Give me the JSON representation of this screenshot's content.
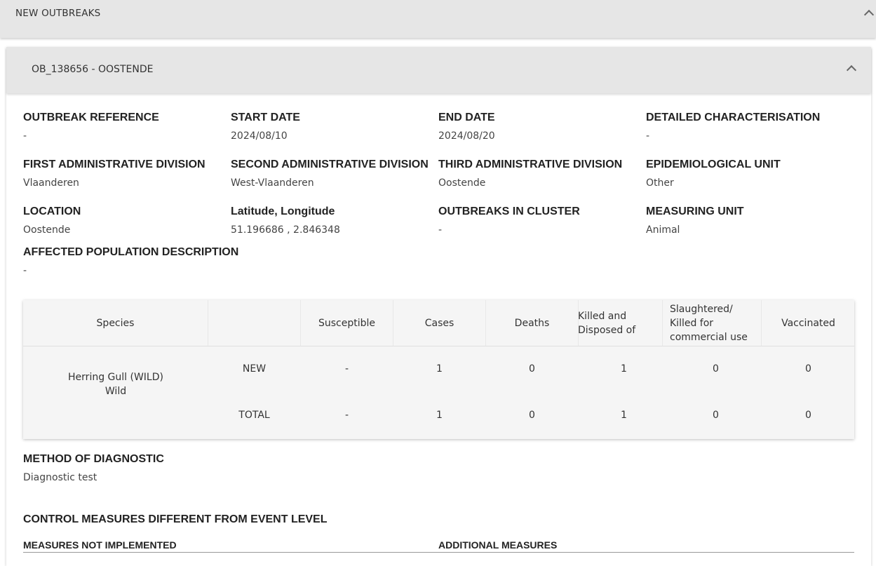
{
  "section": {
    "title": "NEW OUTBREAKS"
  },
  "outbreak": {
    "header": "OB_138656 - OOSTENDE",
    "fields": {
      "outbreak_reference": {
        "label": "OUTBREAK REFERENCE",
        "value": "-"
      },
      "start_date": {
        "label": "START DATE",
        "value": "2024/08/10"
      },
      "end_date": {
        "label": "END DATE",
        "value": "2024/08/20"
      },
      "detailed_characterisation": {
        "label": "DETAILED CHARACTERISATION",
        "value": "-"
      },
      "first_admin_division": {
        "label": "FIRST ADMINISTRATIVE DIVISION",
        "value": "Vlaanderen"
      },
      "second_admin_division": {
        "label": "SECOND ADMINISTRATIVE DIVISION",
        "value": "West-Vlaanderen"
      },
      "third_admin_division": {
        "label": "THIRD ADMINISTRATIVE DIVISION",
        "value": "Oostende"
      },
      "epidemiological_unit": {
        "label": "EPIDEMIOLOGICAL UNIT",
        "value": "Other"
      },
      "location": {
        "label": "LOCATION",
        "value": "Oostende"
      },
      "lat_long": {
        "label": "Latitude, Longitude",
        "value": "51.196686 , 2.846348"
      },
      "outbreaks_in_cluster": {
        "label": "OUTBREAKS IN CLUSTER",
        "value": "-"
      },
      "measuring_unit": {
        "label": "MEASURING UNIT",
        "value": "Animal"
      },
      "affected_population": {
        "label": "AFFECTED POPULATION DESCRIPTION",
        "value": "-"
      }
    },
    "table": {
      "headers": {
        "species": "Species",
        "susceptible": "Susceptible",
        "cases": "Cases",
        "deaths": "Deaths",
        "killed_disposed": "Killed and Disposed of",
        "slaughtered": "Slaughtered/ Killed for commercial use",
        "vaccinated": "Vaccinated"
      },
      "species_name": "Herring Gull (WILD)",
      "species_type": "Wild",
      "rows": [
        {
          "label": "NEW",
          "susceptible": "-",
          "cases": "1",
          "deaths": "0",
          "killed_disposed": "1",
          "slaughtered": "0",
          "vaccinated": "0"
        },
        {
          "label": "TOTAL",
          "susceptible": "-",
          "cases": "1",
          "deaths": "0",
          "killed_disposed": "1",
          "slaughtered": "0",
          "vaccinated": "0"
        }
      ]
    },
    "method_of_diagnostic": {
      "label": "METHOD OF DIAGNOSTIC",
      "value": "Diagnostic test"
    },
    "control_measures": {
      "title": "CONTROL MEASURES DIFFERENT FROM EVENT LEVEL",
      "not_implemented_label": "MEASURES NOT IMPLEMENTED",
      "additional_label": "ADDITIONAL MEASURES"
    }
  }
}
